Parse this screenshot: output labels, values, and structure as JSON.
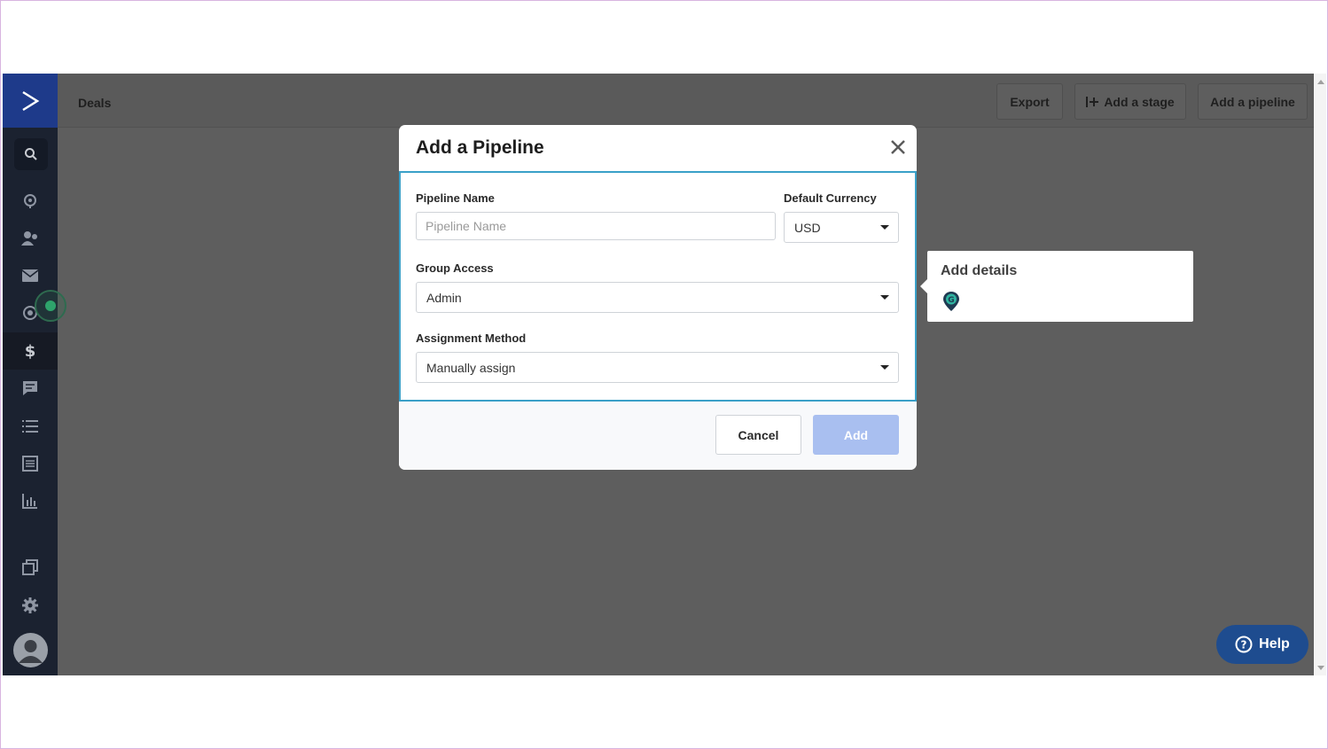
{
  "header": {
    "title": "Deals",
    "buttons": {
      "export": "Export",
      "add_stage": "Add a stage",
      "add_pipeline": "Add a pipeline"
    }
  },
  "sidebar": {
    "items": [
      {
        "icon": "search-icon"
      },
      {
        "icon": "location-pin-icon"
      },
      {
        "icon": "contacts-icon"
      },
      {
        "icon": "mail-icon"
      },
      {
        "icon": "automation-icon"
      },
      {
        "icon": "dollar-icon",
        "active": true
      },
      {
        "icon": "chat-icon"
      },
      {
        "icon": "list-icon"
      },
      {
        "icon": "forms-icon"
      },
      {
        "icon": "reports-icon"
      },
      {
        "icon": "pages-icon"
      },
      {
        "icon": "gear-icon"
      },
      {
        "icon": "avatar"
      }
    ]
  },
  "modal": {
    "title": "Add a Pipeline",
    "pipeline_name": {
      "label": "Pipeline Name",
      "placeholder": "Pipeline Name",
      "value": ""
    },
    "currency": {
      "label": "Default Currency",
      "value": "USD"
    },
    "group_access": {
      "label": "Group Access",
      "value": "Admin"
    },
    "assignment": {
      "label": "Assignment Method",
      "value": "Manually assign"
    },
    "cancel_label": "Cancel",
    "add_label": "Add"
  },
  "tooltip": {
    "title": "Add details"
  },
  "help": {
    "label": "Help"
  },
  "colors": {
    "accent": "#3aa0c8",
    "sidebar": "#1b2230",
    "logo_bg": "#1e3a8a",
    "add_button": "#a9bff0",
    "help_button": "#1e4c8f"
  }
}
